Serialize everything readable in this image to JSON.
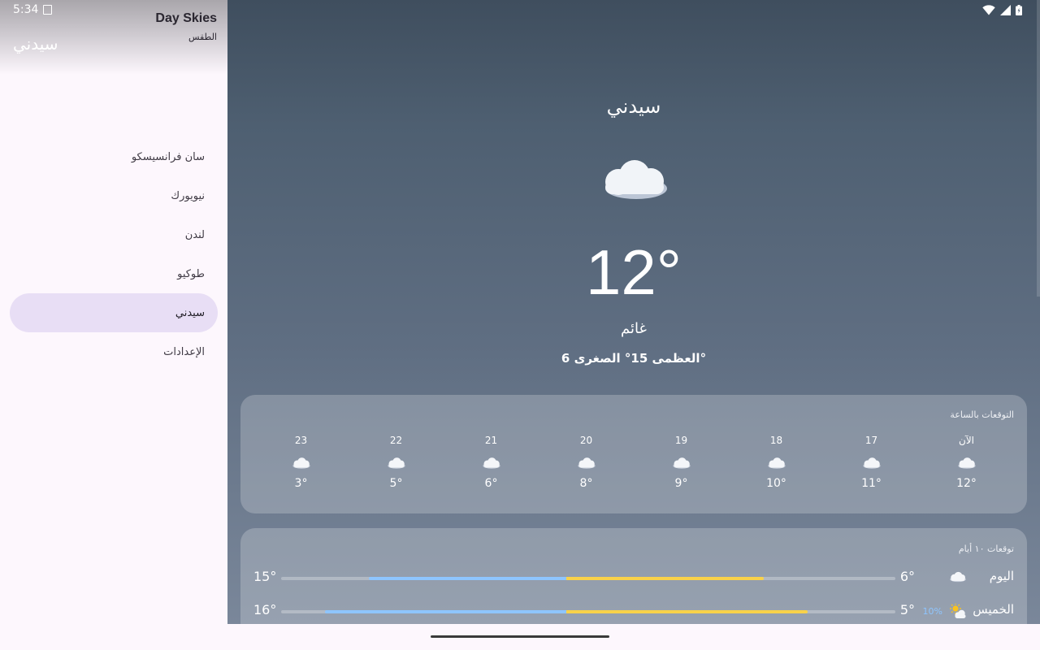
{
  "status": {
    "time": "5:34"
  },
  "drawer": {
    "app_title": "Day Skies",
    "app_subtitle": "الطقس",
    "current_city": "سيدني",
    "items": [
      {
        "label": "سان فرانسيسكو",
        "active": false
      },
      {
        "label": "نيويورك",
        "active": false
      },
      {
        "label": "لندن",
        "active": false
      },
      {
        "label": "طوكيو",
        "active": false
      },
      {
        "label": "سيدني",
        "active": true
      },
      {
        "label": "الإعدادات",
        "active": false
      }
    ]
  },
  "current": {
    "city": "سيدني",
    "icon": "cloud-icon",
    "temperature": "12°",
    "condition": "غائم",
    "hi_lo": "العظمى 15° الصغرى 6°"
  },
  "hourly": {
    "title": "التوقعات بالساعة",
    "hours": [
      {
        "label": "الآن",
        "temp": "12°",
        "icon": "cloud-icon"
      },
      {
        "label": "17",
        "temp": "11°",
        "icon": "cloud-icon"
      },
      {
        "label": "18",
        "temp": "10°",
        "icon": "cloud-icon"
      },
      {
        "label": "19",
        "temp": "9°",
        "icon": "cloud-icon"
      },
      {
        "label": "20",
        "temp": "8°",
        "icon": "cloud-icon"
      },
      {
        "label": "21",
        "temp": "6°",
        "icon": "cloud-icon"
      },
      {
        "label": "22",
        "temp": "5°",
        "icon": "cloud-icon"
      },
      {
        "label": "23",
        "temp": "3°",
        "icon": "cloud-icon"
      }
    ]
  },
  "daily": {
    "title": "توقعات ١٠ أيام",
    "days": [
      {
        "name": "اليوم",
        "icon": "cloud-icon",
        "precip": "",
        "low": "6°",
        "high": "15°",
        "range_start": 0.143,
        "range_end": 0.786
      },
      {
        "name": "الخميس",
        "icon": "partly-sunny-icon",
        "precip": "10%",
        "low": "5°",
        "high": "16°",
        "range_start": 0.071,
        "range_end": 0.857
      }
    ]
  },
  "colors": {
    "drawer_active": "#e8def5",
    "range_cold": "#8ec5ff",
    "range_warm": "#f9d24a"
  }
}
